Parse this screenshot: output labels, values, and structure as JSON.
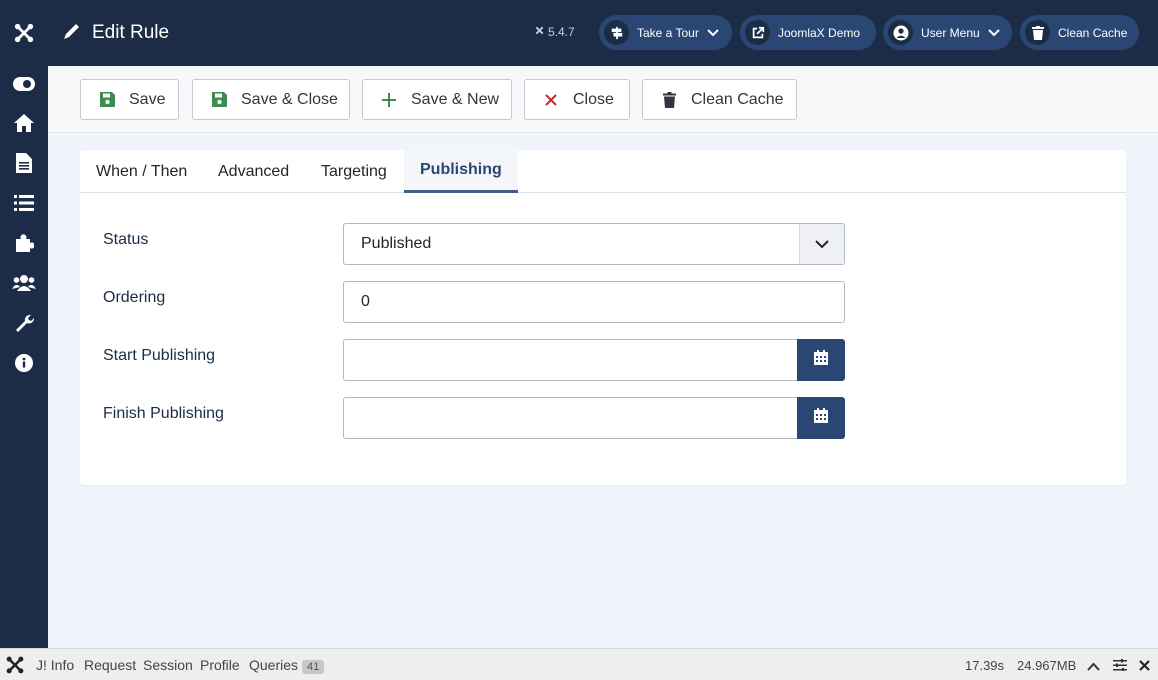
{
  "header": {
    "title": "Edit Rule",
    "version": "5.4.7",
    "take_tour": "Take a Tour",
    "demo": "JoomlaX Demo",
    "user_menu": "User Menu",
    "clean_cache": "Clean Cache"
  },
  "sidebar": {
    "items": [
      {
        "icon": "toggle-icon"
      },
      {
        "icon": "home-icon"
      },
      {
        "icon": "file-icon"
      },
      {
        "icon": "list-icon"
      },
      {
        "icon": "puzzle-icon"
      },
      {
        "icon": "users-icon"
      },
      {
        "icon": "wrench-icon"
      },
      {
        "icon": "info-icon"
      }
    ]
  },
  "toolbar": {
    "save": "Save",
    "save_close": "Save & Close",
    "save_new": "Save & New",
    "close": "Close",
    "clean_cache": "Clean Cache"
  },
  "tabs": [
    "When / Then",
    "Advanced",
    "Targeting",
    "Publishing"
  ],
  "active_tab": "Publishing",
  "form": {
    "status_label": "Status",
    "status_value": "Published",
    "ordering_label": "Ordering",
    "ordering_value": "0",
    "start_label": "Start Publishing",
    "start_value": "",
    "finish_label": "Finish Publishing",
    "finish_value": ""
  },
  "debugbar": {
    "info": "J! Info",
    "request": "Request",
    "session": "Session",
    "profile": "Profile",
    "queries": "Queries",
    "queries_count": "41",
    "time": "17.39s",
    "memory": "24.967MB"
  },
  "colors": {
    "header_bg": "#1c2c46",
    "accent": "#2a4773",
    "save_green": "#3f8a4f",
    "close_red": "#c52827"
  }
}
